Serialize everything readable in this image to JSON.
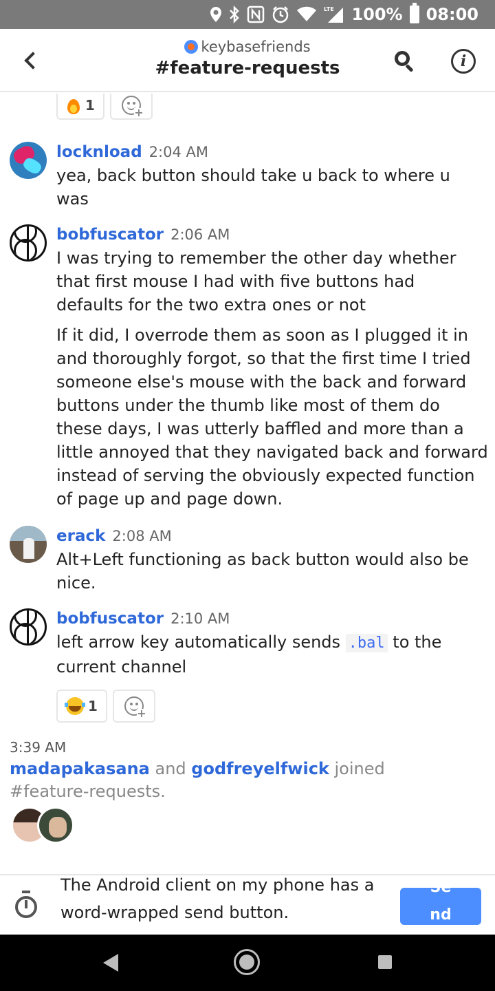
{
  "status_bar": {
    "battery": "100%",
    "time": "08:00",
    "network": "LTE",
    "icons": [
      "location-icon",
      "bluetooth-icon",
      "nfc-icon",
      "alarm-icon",
      "wifi-icon",
      "signal-icon",
      "battery-icon"
    ]
  },
  "header": {
    "team": "keybasefriends",
    "channel": "#feature-requests",
    "icons": [
      "back-icon",
      "search-icon",
      "info-icon"
    ]
  },
  "top_reaction": {
    "emoji": "fire",
    "count": "1"
  },
  "messages": [
    {
      "author": "locknload",
      "time": "2:04 AM",
      "paragraphs": [
        "yea, back button should take u back to where u was"
      ]
    },
    {
      "author": "bobfuscator",
      "time": "2:06 AM",
      "paragraphs": [
        "I was trying to remember the other day whether that first mouse I had with five buttons had defaults for the two extra ones or not",
        "If it did, I overrode them as soon as I plugged it in and thoroughly forgot, so that the first time I tried someone else's mouse with the back and forward buttons under the thumb like most of them do these days, I was utterly baffled and more than a little annoyed that they navigated back and forward instead of serving the obviously expected function of page up and page down."
      ]
    },
    {
      "author": "erack",
      "time": "2:08 AM",
      "paragraphs": [
        "Alt+Left functioning as back button would also be nice."
      ]
    },
    {
      "author": "bobfuscator",
      "time": "2:10 AM",
      "text_before": "left arrow key automatically sends ",
      "code": ".bal",
      "text_after": " to the current channel",
      "reaction": {
        "emoji": "joy",
        "count": "1"
      }
    }
  ],
  "system": {
    "time": "3:39 AM",
    "user1": "madapakasana",
    "and": " and ",
    "user2": "godfreyelfwick",
    "joined": " joined #feature-requests."
  },
  "composer": {
    "text": "The Android client on my phone has a word-wrapped send button.",
    "send_label": "Send"
  },
  "nav": {
    "icons": [
      "back-triangle-icon",
      "home-circle-icon",
      "recents-square-icon"
    ]
  }
}
